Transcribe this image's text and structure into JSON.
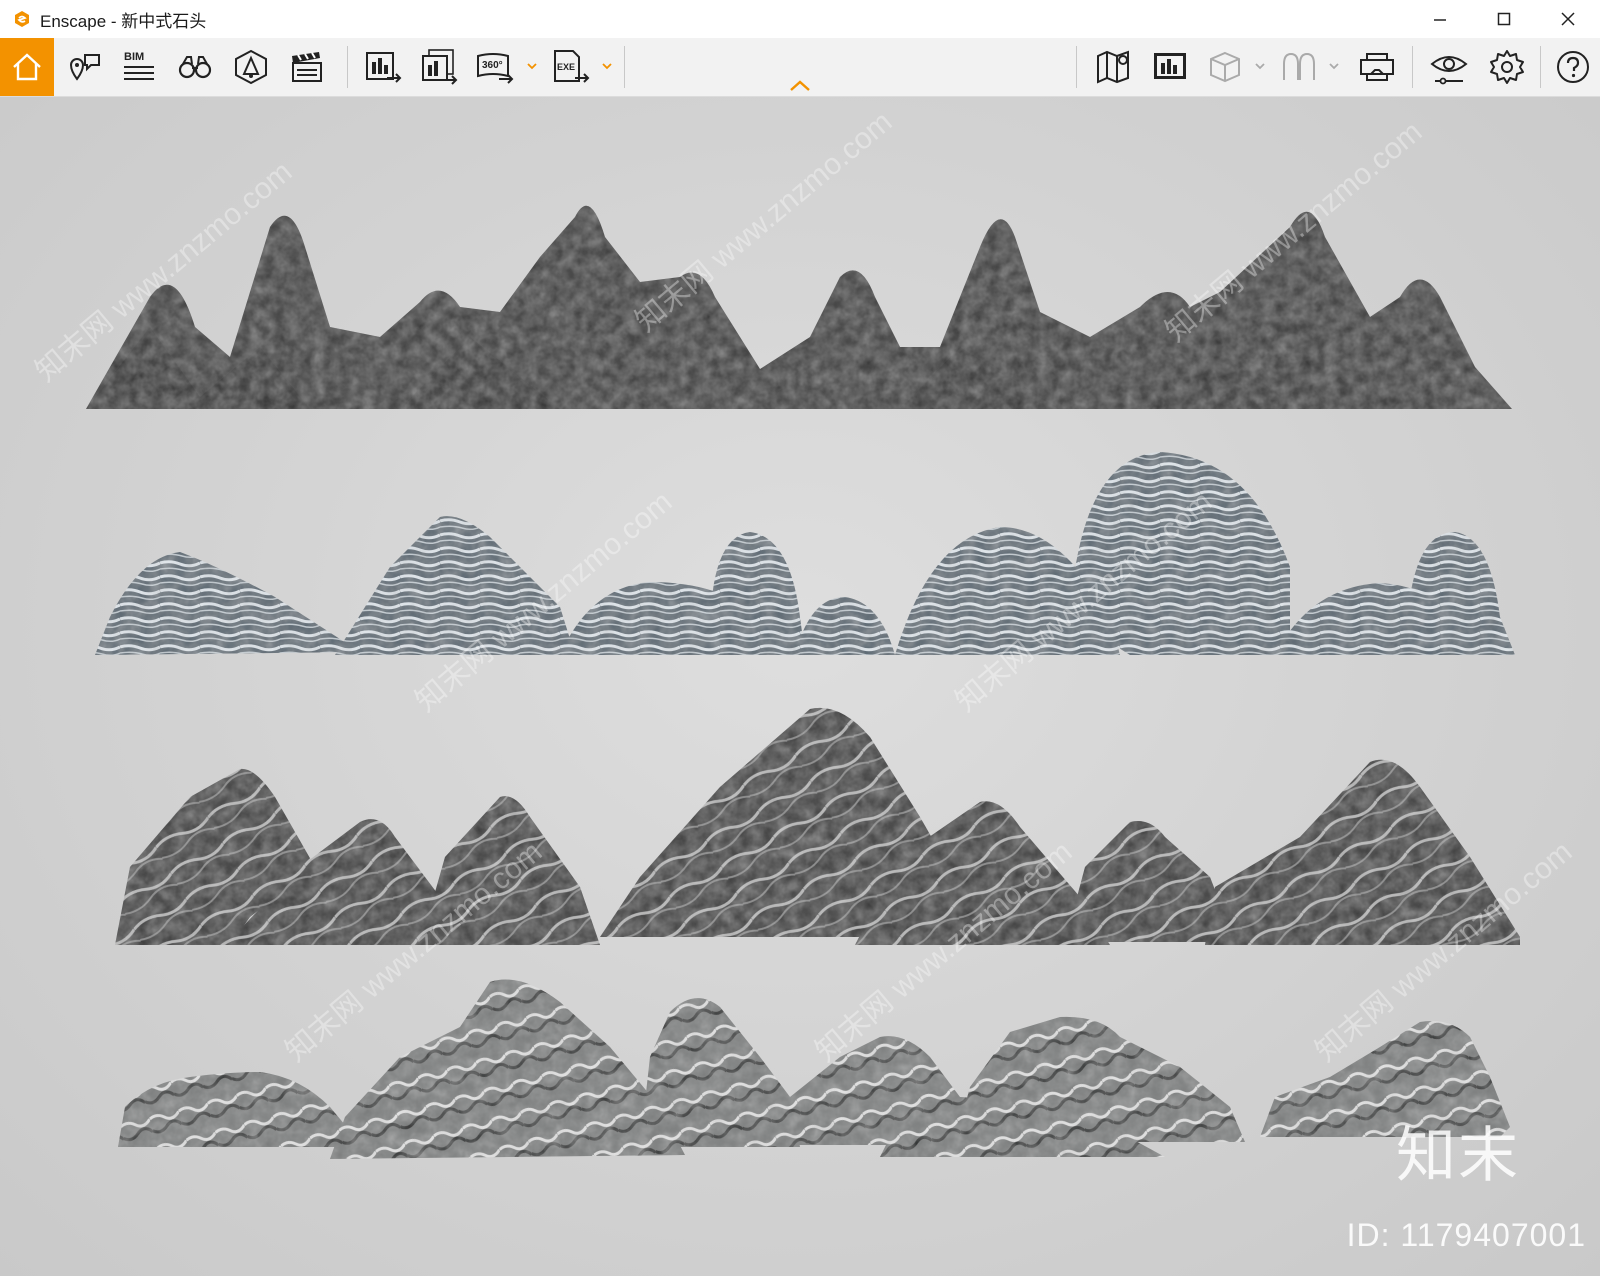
{
  "window": {
    "title": "Enscape - 新中式石头",
    "controls": [
      "minimize",
      "maximize",
      "close"
    ]
  },
  "toolbar": {
    "left_tools": [
      {
        "icon": "home-icon",
        "active": true
      },
      {
        "icon": "map-pin-chat-icon"
      },
      {
        "icon": "bim-icon",
        "label": "BIM"
      },
      {
        "icon": "binoculars-icon"
      },
      {
        "icon": "light-view-icon"
      },
      {
        "icon": "clapperboard-icon"
      },
      {
        "icon": "screenshot-export-icon"
      },
      {
        "icon": "batch-export-icon"
      },
      {
        "icon": "panorama-export-icon",
        "label": "360°"
      },
      {
        "icon": "exe-export-icon",
        "label": "EXE"
      }
    ],
    "right_tools": [
      {
        "icon": "map-icon"
      },
      {
        "icon": "asset-library-icon"
      },
      {
        "icon": "cube-icon"
      },
      {
        "icon": "tree-icon"
      },
      {
        "icon": "vr-headset-icon"
      },
      {
        "icon": "eye-settings-icon"
      },
      {
        "icon": "gear-icon"
      },
      {
        "icon": "help-icon"
      }
    ],
    "accent_color": "#f39200"
  },
  "viewport": {
    "watermark_logo": "知末",
    "watermark_id": "ID: 1179407001",
    "diagonal_watermark": "知末网 www.znzmo.com"
  }
}
